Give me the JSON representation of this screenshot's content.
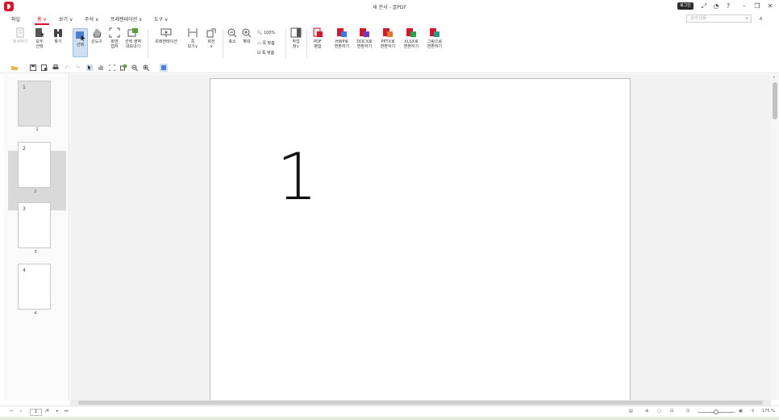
{
  "window": {
    "title": "새 문서 - 꿀PDF",
    "login_label": "로그인"
  },
  "menu": {
    "file": "파일",
    "home": "홈 ∨",
    "view": "보기 ∨",
    "annotate": "주석 ∨",
    "presentation": "프레젠테이션 ∨",
    "tools": "도구 ∨"
  },
  "search": {
    "placeholder": "검색 내용"
  },
  "ribbon": {
    "copy": "복사하기",
    "select_all": [
      "모두",
      "선택"
    ],
    "find": "찾기",
    "select": "선택",
    "hand": "손도구",
    "screen_capture": [
      "화면",
      "캡처"
    ],
    "export_selection": [
      "선택 영역",
      "내보내기"
    ],
    "presentation": "프레젠테이션",
    "page_view": [
      "쪽",
      "보기∨"
    ],
    "rotate": [
      "회전",
      "∨"
    ],
    "zoom_out": "축소",
    "zoom_in": "확대",
    "zoom_100": "100%",
    "fit_width": "쪽 맞춤",
    "fit_page": "폭 맞춤",
    "work_page": [
      "작업",
      "창∨"
    ],
    "pdf_merge": [
      "PDF",
      "병합"
    ],
    "to_hwp": [
      "HWP로",
      "변환하기"
    ],
    "to_docx": [
      "DOCX로",
      "변환하기"
    ],
    "to_pptx": [
      "PPTX로",
      "변환하기"
    ],
    "to_xlsx": [
      "XLSX로",
      "변환하기"
    ],
    "to_image": [
      "그림으로",
      "변환하기"
    ]
  },
  "thumbnails": [
    {
      "num": "1",
      "label": "1"
    },
    {
      "num": "2",
      "label": "2"
    },
    {
      "num": "3",
      "label": "3"
    },
    {
      "num": "4",
      "label": "4"
    }
  ],
  "document": {
    "page_number_text": "1"
  },
  "status": {
    "current_page": "1",
    "total_pages": "/4",
    "zoom": "175 %"
  },
  "colors": {
    "accent": "#d3172e",
    "selection": "#cfe0f5"
  }
}
